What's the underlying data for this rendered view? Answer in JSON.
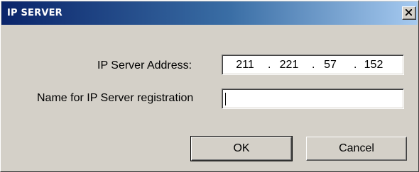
{
  "window": {
    "title": "IP SERVER"
  },
  "form": {
    "ip_label": "IP Server Address:",
    "ip_octets": [
      "211",
      "221",
      "57",
      "152"
    ],
    "ip_separator": ".",
    "name_label": "Name for IP Server registration",
    "name_value": ""
  },
  "buttons": {
    "ok": "OK",
    "cancel": "Cancel"
  },
  "icons": {
    "close": "close-icon"
  },
  "colors": {
    "titlebar_start": "#0a246a",
    "titlebar_end": "#a6caf0",
    "face": "#d4d0c8"
  }
}
